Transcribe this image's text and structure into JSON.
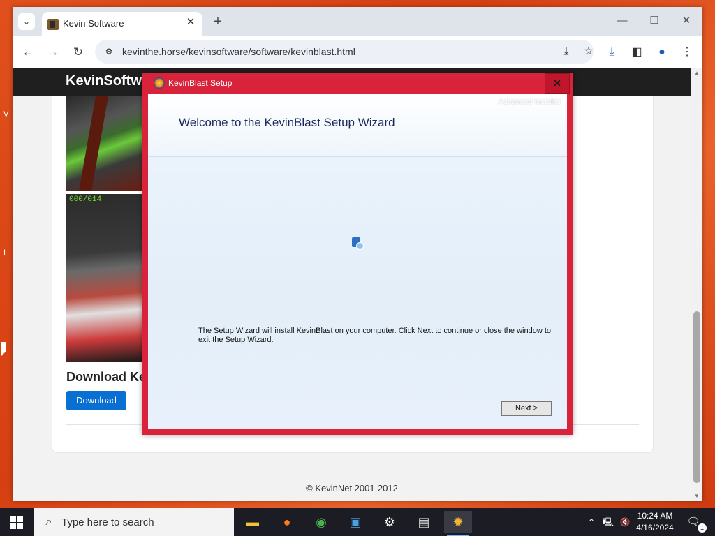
{
  "browser": {
    "tab_title": "Kevin Software",
    "tab_close_glyph": "✕",
    "new_tab_glyph": "+",
    "url": "kevinthe.horse/kevinsoftware/software/kevinblast.html",
    "window_controls": {
      "minimize": "—",
      "maximize": "☐",
      "close": "✕"
    },
    "icons": [
      "tab-search-icon",
      "back-icon",
      "forward-icon",
      "reload-icon",
      "site-info-icon",
      "install-icon",
      "bookmark-star-icon",
      "downloads-icon",
      "side-panel-icon",
      "profile-icon",
      "menu-icon"
    ]
  },
  "website": {
    "brand": "KevinSoftwa",
    "hud_text": "000/014",
    "download_heading": "Download Ke",
    "download_button": "Download",
    "footer": "© KevinNet 2001-2012"
  },
  "dialog": {
    "title": "KevinBlast Setup",
    "close_glyph": "✕",
    "brandmark": "Advanced Installer",
    "heading": "Welcome to the KevinBlast Setup Wizard",
    "body_text": "The Setup Wizard will install KevinBlast on your computer. Click Next to continue or close the window to exit the Setup Wizard.",
    "next_button": "Next >",
    "accent_color": "#d9233a"
  },
  "desktop": {
    "side_marks": [
      "V",
      "I"
    ]
  },
  "taskbar": {
    "search_placeholder": "Type here to search",
    "apps": [
      "file-explorer",
      "firefox",
      "chrome",
      "network-app",
      "settings",
      "installer-app",
      "kevinblast-setup"
    ],
    "time": "10:24 AM",
    "date": "4/16/2024",
    "notification_count": "1"
  }
}
